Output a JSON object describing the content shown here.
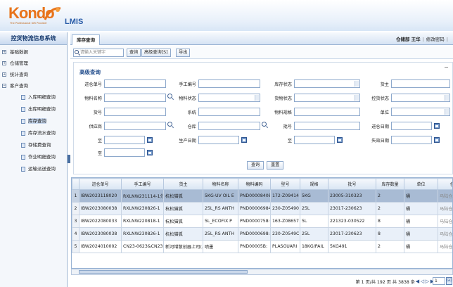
{
  "header": {
    "logo_text": "Kondo",
    "logo_tagline": "The Professional Gift Provider",
    "app_name": "LMIS"
  },
  "sidebar": {
    "title": "控货物流信息系统",
    "items": [
      {
        "label": "基础数据",
        "expander": "+"
      },
      {
        "label": "仓储管理",
        "expander": "+"
      },
      {
        "label": "统计查询",
        "expander": "+"
      },
      {
        "label": "客户查询",
        "expander": "−"
      }
    ],
    "subitems": [
      {
        "label": "入库明细查询"
      },
      {
        "label": "出库明细查询"
      },
      {
        "label": "库存查询"
      },
      {
        "label": "库存流水查询"
      },
      {
        "label": "存储费查询"
      },
      {
        "label": "作业明细查询"
      },
      {
        "label": "运输派送查询"
      }
    ]
  },
  "tabbar": {
    "active_tab": "库存查询",
    "user_area": "仓储部 王华",
    "link_change": "修改密码",
    "sep": "|"
  },
  "toolbar": {
    "search_placeholder": "请输入关键字",
    "query_button": "查询",
    "advanced_button": "高级查询[S]",
    "export_button": "导出"
  },
  "advanced_search": {
    "title": "高级查询",
    "fields": {
      "f1": "进仓单号",
      "f2": "手工编号",
      "f3": "库存状态",
      "f4": "货主",
      "f5": "物料名称",
      "f6": "物料状态",
      "f7": "货物状态",
      "f8": "控货状态",
      "f9": "货号",
      "f10": "系统",
      "f11": "物料规格",
      "f12": "单位",
      "f13": "供应商",
      "f14": "仓库",
      "f15": "批号",
      "f16": "进仓日期",
      "f17": "至",
      "f18": "生产日期",
      "f19": "至",
      "f20": "失效日期",
      "f21": "至"
    },
    "query_button": "查询",
    "reset_button": "重置"
  },
  "grid": {
    "columns": [
      "进仓单号",
      "手工编号",
      "货主",
      "物料名称",
      "物料编码",
      "型号",
      "规格",
      "批号",
      "库存数量",
      "单位",
      "仓"
    ],
    "rows": [
      {
        "n": "1",
        "c": [
          "IBW2023118020",
          "RXLNW231114-1分",
          "杭松猫狐",
          "5KG-UV OIL E",
          "PND00008408",
          "172-Z09414",
          "5KG",
          "23005-310323",
          "2",
          "桶",
          "马陆仓库"
        ]
      },
      {
        "n": "2",
        "c": [
          "IBW2023080038",
          "RXLNW230826-1",
          "杭松猫狐",
          "25L_RS ANTH",
          "PND00006984",
          "230-Z05490",
          "25L",
          "23017-230623",
          "2",
          "桶",
          "马陆仓库"
        ]
      },
      {
        "n": "3",
        "c": [
          "IBW2022080033",
          "RXLNW220818-1",
          "杭松猫狐",
          "5L_ECOFIX P",
          "PND0000758:",
          "163-Z08657",
          "5L",
          "221323-030522",
          "8",
          "桶",
          "马陆仓库"
        ]
      },
      {
        "n": "4",
        "c": [
          "IBW2023080038",
          "RXLNW230826-1",
          "杭松猫狐",
          "25L_RS ANTH",
          "PND0000698:",
          "230-Z0549C",
          "25L",
          "23017-230623",
          "8",
          "桶",
          "马陆仓库"
        ]
      },
      {
        "n": "5",
        "c": [
          "IBW2024010002",
          "CN23-0623&CN23",
          "新河增散创器上司(上",
          "喷墨",
          "PND00005B:",
          "PLASGUARI",
          "18KG/PAIL",
          "5KG491",
          "2",
          "桶",
          "马陆仓库"
        ]
      }
    ]
  },
  "pager": {
    "summary": "第 1 页/共 192 页  共 3838 条",
    "page_value": "1",
    "go": "GO"
  }
}
